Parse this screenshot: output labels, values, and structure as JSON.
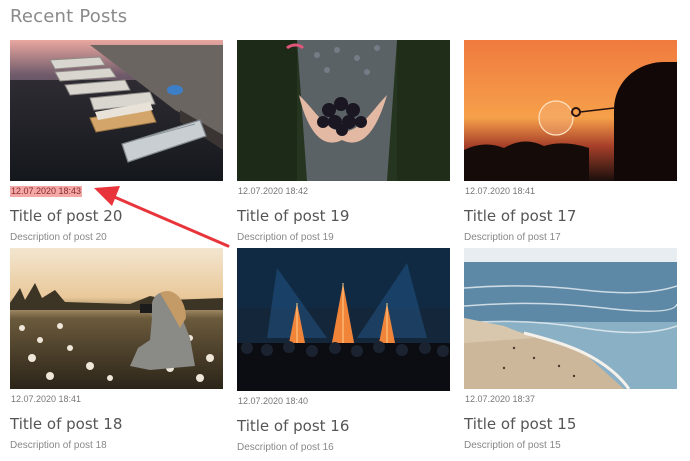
{
  "section": {
    "title": "Recent Posts"
  },
  "posts": [
    {
      "date": "12.07.2020 18:43",
      "title": "Title of post 20",
      "description": "Description of post 20",
      "image": "boats-at-dock"
    },
    {
      "date": "12.07.2020 18:42",
      "title": "Title of post 19",
      "description": "Description of post 19",
      "image": "hands-with-blackberries"
    },
    {
      "date": "12.07.2020 18:41",
      "title": "Title of post 17",
      "description": "Description of post 17",
      "image": "sunset-soap-bubble"
    },
    {
      "date": "12.07.2020 18:41",
      "title": "Title of post 18",
      "description": "Description of post 18",
      "image": "photographer-in-field"
    },
    {
      "date": "12.07.2020 18:40",
      "title": "Title of post 16",
      "description": "Description of post 16",
      "image": "festival-stage"
    },
    {
      "date": "12.07.2020 18:37",
      "title": "Title of post 15",
      "description": "Description of post 15",
      "image": "beach-coastline"
    }
  ],
  "annotation": {
    "color": "#e8353b"
  }
}
